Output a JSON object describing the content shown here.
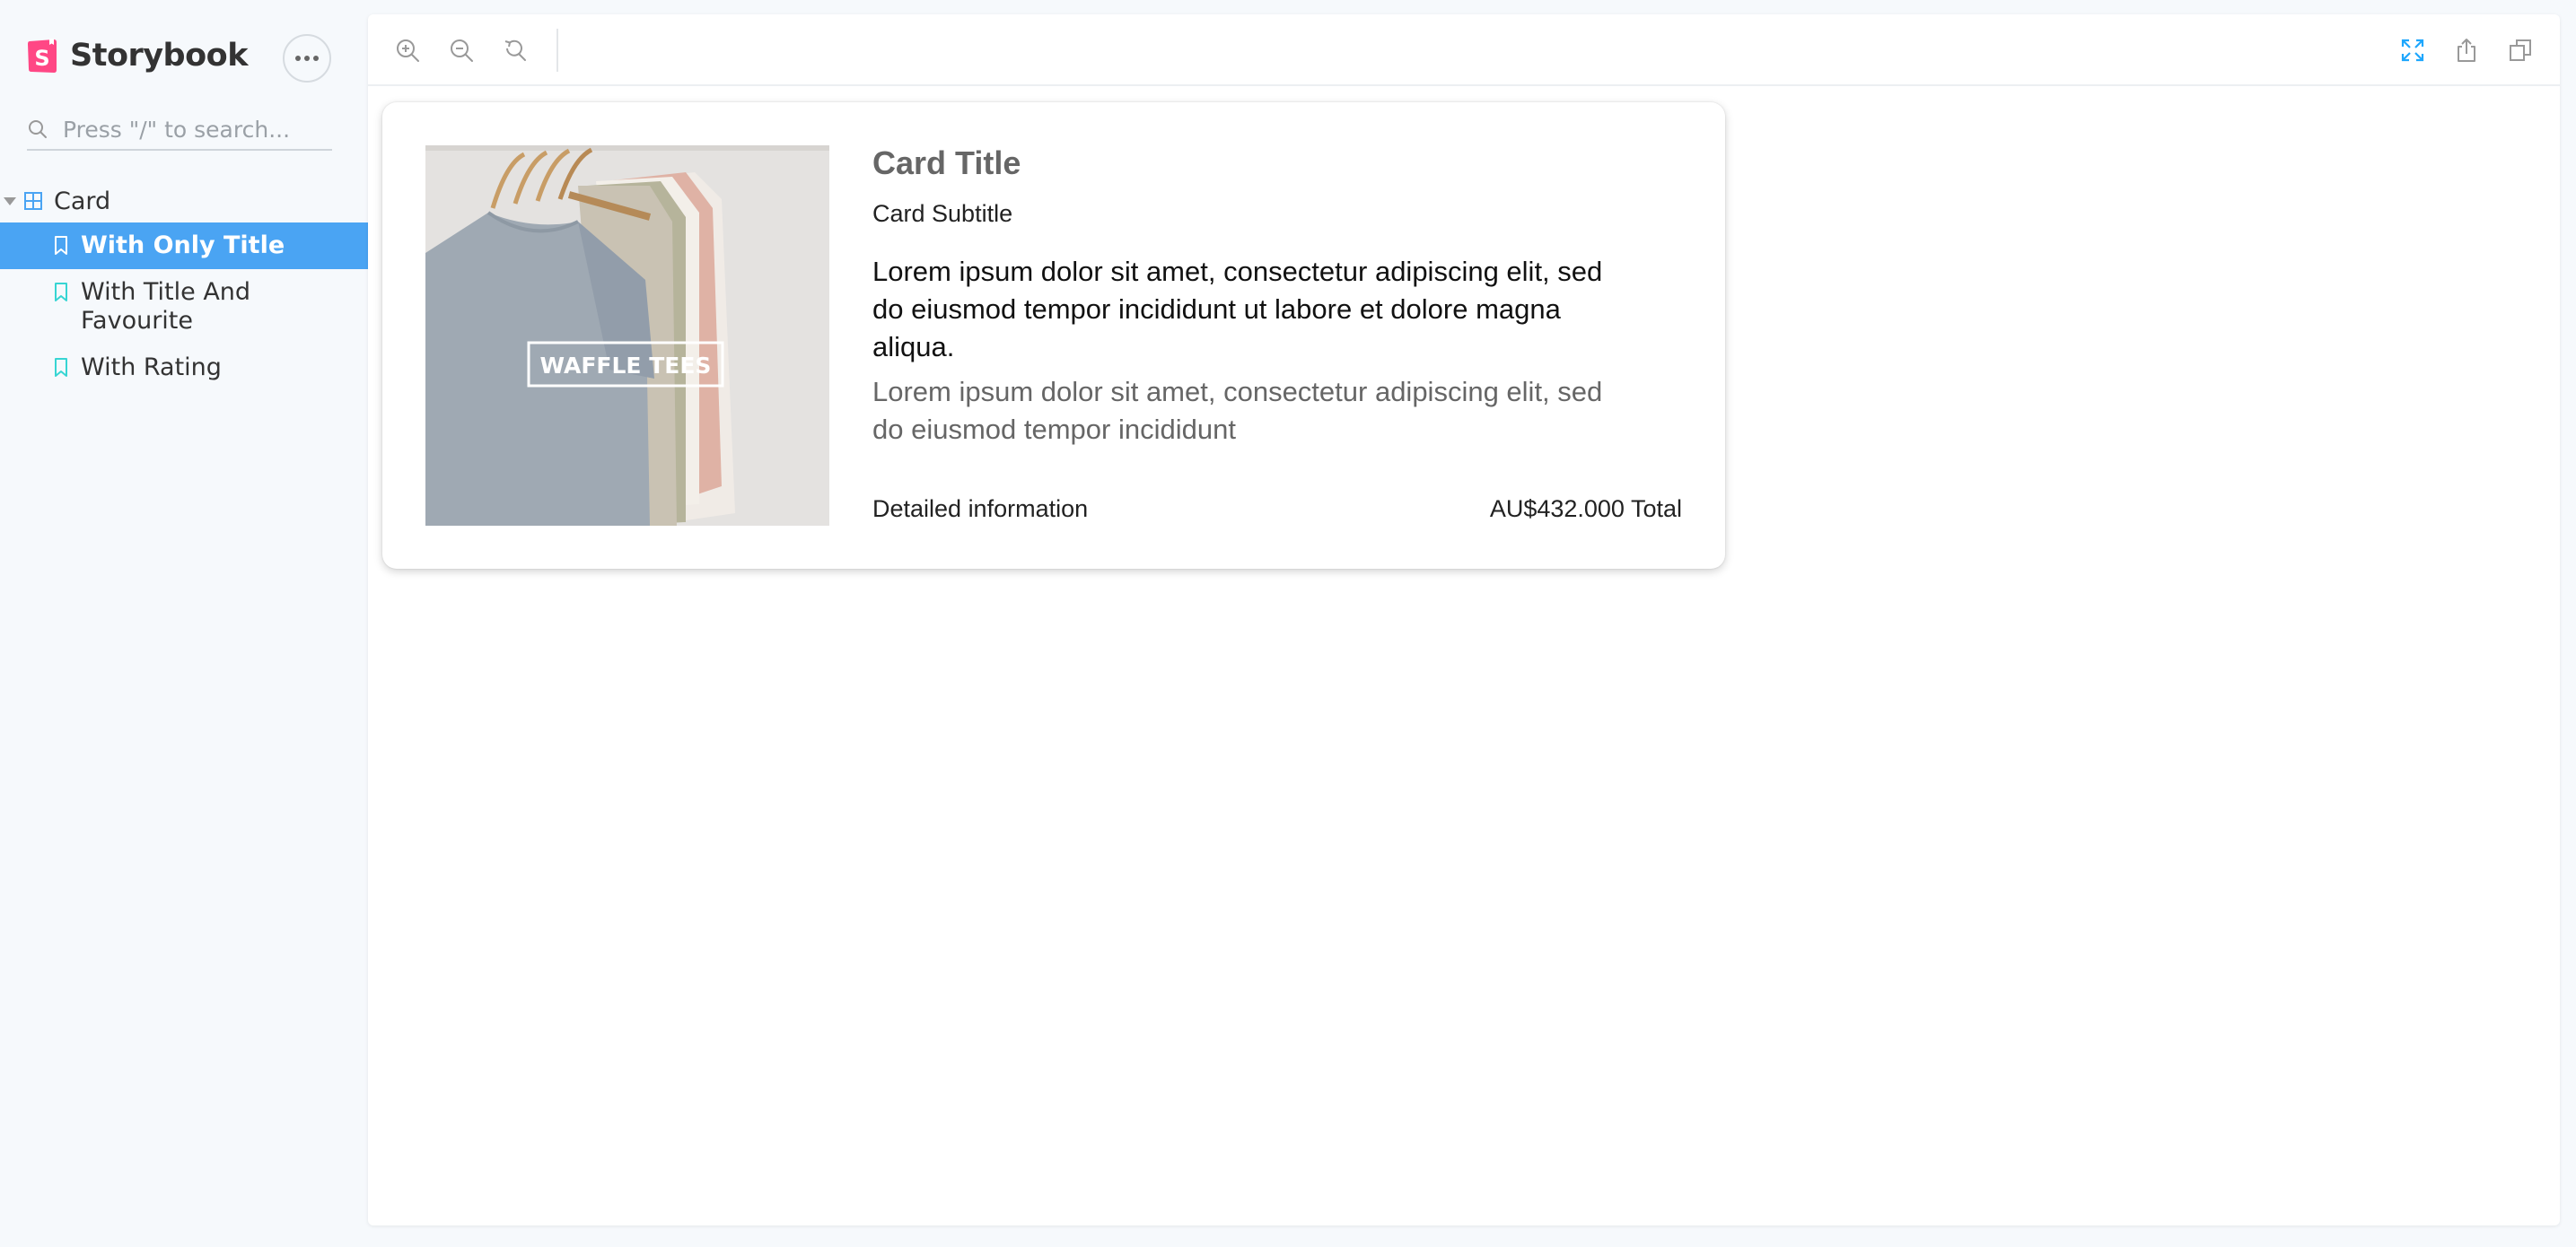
{
  "app": {
    "name": "Storybook"
  },
  "sidebar": {
    "search_placeholder": "Press \"/\" to search...",
    "group_label": "Card",
    "items": [
      {
        "label": "With Only Title",
        "active": true
      },
      {
        "label": "With Title And Favourite",
        "active": false
      },
      {
        "label": "With Rating",
        "active": false
      }
    ]
  },
  "toolbar": {
    "left_icons": [
      "zoom-in-icon",
      "zoom-out-icon",
      "reset-zoom-icon"
    ],
    "right_icons": [
      "fullscreen-icon",
      "share-icon",
      "copy-icon"
    ]
  },
  "card": {
    "image_text": "WAFFLE TEES",
    "title": "Card Title",
    "subtitle": "Card Subtitle",
    "text": "Lorem ipsum dolor sit amet, consectetur adipiscing elit, sed do eiusmod tempor incididunt ut labore et dolore magna aliqua.",
    "secondary_text": "Lorem ipsum dolor sit amet, consectetur adipiscing elit, sed do eiusmod tempor incididunt",
    "footer_left": "Detailed information",
    "footer_right": "AU$432.000 Total"
  },
  "colors": {
    "accent": "#4aa4f3",
    "brand": "#ff4785",
    "sidebar_bg": "#f6f9fc",
    "bookmark": "#37d5d3"
  }
}
